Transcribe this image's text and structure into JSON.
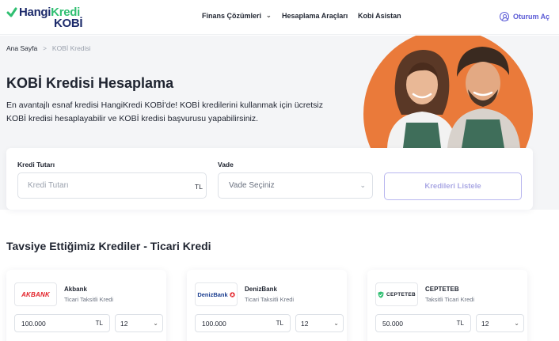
{
  "brand": {
    "line1_a": "Hangi",
    "line1_b": "Kredi",
    "line2": "KOBİ"
  },
  "nav": [
    {
      "label": "Finans Çözümleri",
      "has_dropdown": true
    },
    {
      "label": "Hesaplama Araçları",
      "has_dropdown": false
    },
    {
      "label": "Kobi Asistan",
      "has_dropdown": false
    }
  ],
  "login": {
    "label": "Oturum Aç",
    "icon": "user-circle-icon"
  },
  "breadcrumb": {
    "home": "Ana Sayfa",
    "separator": ">",
    "current": "KOBİ Kredisi"
  },
  "hero": {
    "title": "KOBİ Kredisi Hesaplama",
    "description": "En avantajlı esnaf kredisi HangiKredi KOBİ'de! KOBİ kredilerini kullanmak için ücretsiz KOBİ kredisi hesaplayabilir ve KOBİ kredisi başvurusu yapabilirsiniz.",
    "accent_color": "#ea7a3a"
  },
  "form": {
    "amount_label": "Kredi Tutarı",
    "amount_placeholder": "Kredi Tutarı",
    "amount_suffix": "TL",
    "term_label": "Vade",
    "term_placeholder": "Vade Seçiniz",
    "submit_label": "Kredileri Listele"
  },
  "section_title": "Tavsiye Ettiğimiz Krediler - Ticari Kredi",
  "loans": [
    {
      "bank": "Akbank",
      "logo_text": "AKBANK",
      "product": "Ticari Taksitli Kredi",
      "amount": "100.000",
      "currency": "TL",
      "term": "12"
    },
    {
      "bank": "DenizBank",
      "logo_text": "DenizBank",
      "product": "Ticari Taksitli Kredi",
      "amount": "100.000",
      "currency": "TL",
      "term": "12"
    },
    {
      "bank": "CEPTETEB",
      "logo_text": "CEPTETEB",
      "product": "Taksitli Ticari Kredi",
      "amount": "50.000",
      "currency": "TL",
      "term": "12"
    }
  ],
  "colors": {
    "brand_navy": "#1d2b6b",
    "brand_green": "#2fbf71",
    "primary": "#5b5bd6"
  }
}
